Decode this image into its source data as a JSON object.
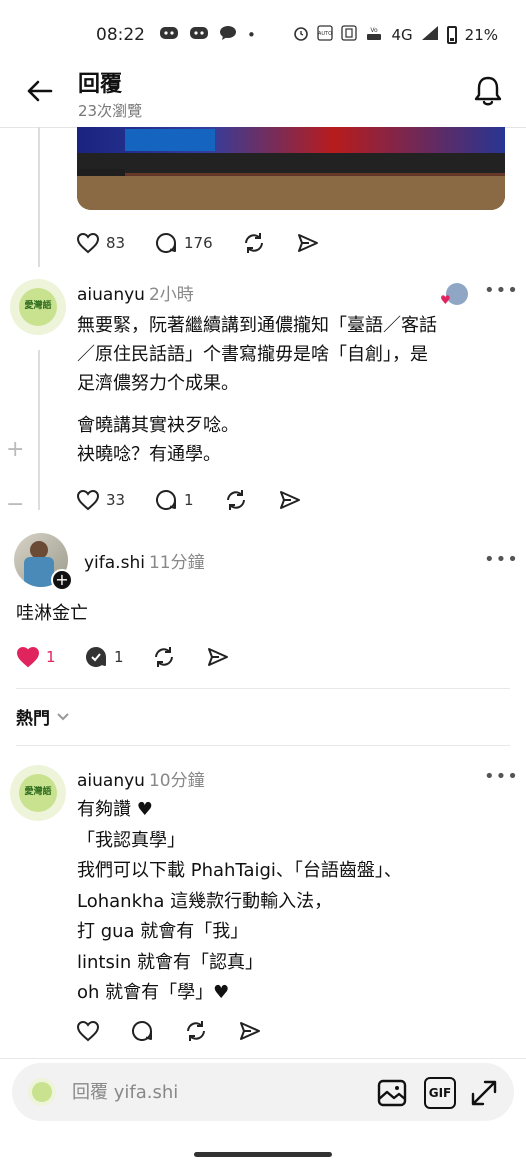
{
  "status_bar": {
    "time": "08:22",
    "battery": "21%",
    "network": "4G",
    "icons": [
      "discord-icon",
      "discord-icon",
      "chat-icon",
      "dot",
      "alarm-icon",
      "nfc-icon",
      "volte-icon",
      "signal-icon",
      "battery-icon"
    ]
  },
  "header": {
    "title": "回覆",
    "subtitle": "23次瀏覽",
    "back_icon": "arrow-left-icon",
    "notification_icon": "bell-icon"
  },
  "top_post": {
    "like_count": "83",
    "comment_count": "176"
  },
  "reply_1": {
    "username": "aiuanyu",
    "time": "2小時",
    "avatar_text": "愛灣語",
    "paragraph1": [
      "無要緊，阮著繼續講到通儂攏知「臺語／客話",
      "／原住民話語」个書寫攏毋是啥「自創」，是",
      "足濟儂努力个成果。"
    ],
    "paragraph2": [
      "會曉講其實袂歹唸。",
      "袂曉唸？有通學。"
    ],
    "like_count": "33",
    "comment_count": "1"
  },
  "reply_2": {
    "username": "yifa.shi",
    "time": "11分鐘",
    "text": "哇淋金亡",
    "like_count": "1",
    "comment_count": "1",
    "liked": true
  },
  "sort": {
    "label": "熱門"
  },
  "reply_3": {
    "username": "aiuanyu",
    "time": "10分鐘",
    "avatar_text": "愛灣語",
    "lines": [
      "有夠讚 ♥",
      "「我認真學」",
      "我們可以下載 PhahTaigi、「台語齒盤」、",
      "Lohankha 這幾款行動輸入法，",
      "打 gua 就會有「我」",
      "lintsin 就會有「認真」",
      "oh 就會有「學」♥"
    ]
  },
  "composer": {
    "placeholder": "回覆 yifa.shi",
    "gif_label": "GIF"
  },
  "colors": {
    "liked": "#e0245e",
    "muted": "#888888",
    "thread_line": "#dddddd"
  }
}
